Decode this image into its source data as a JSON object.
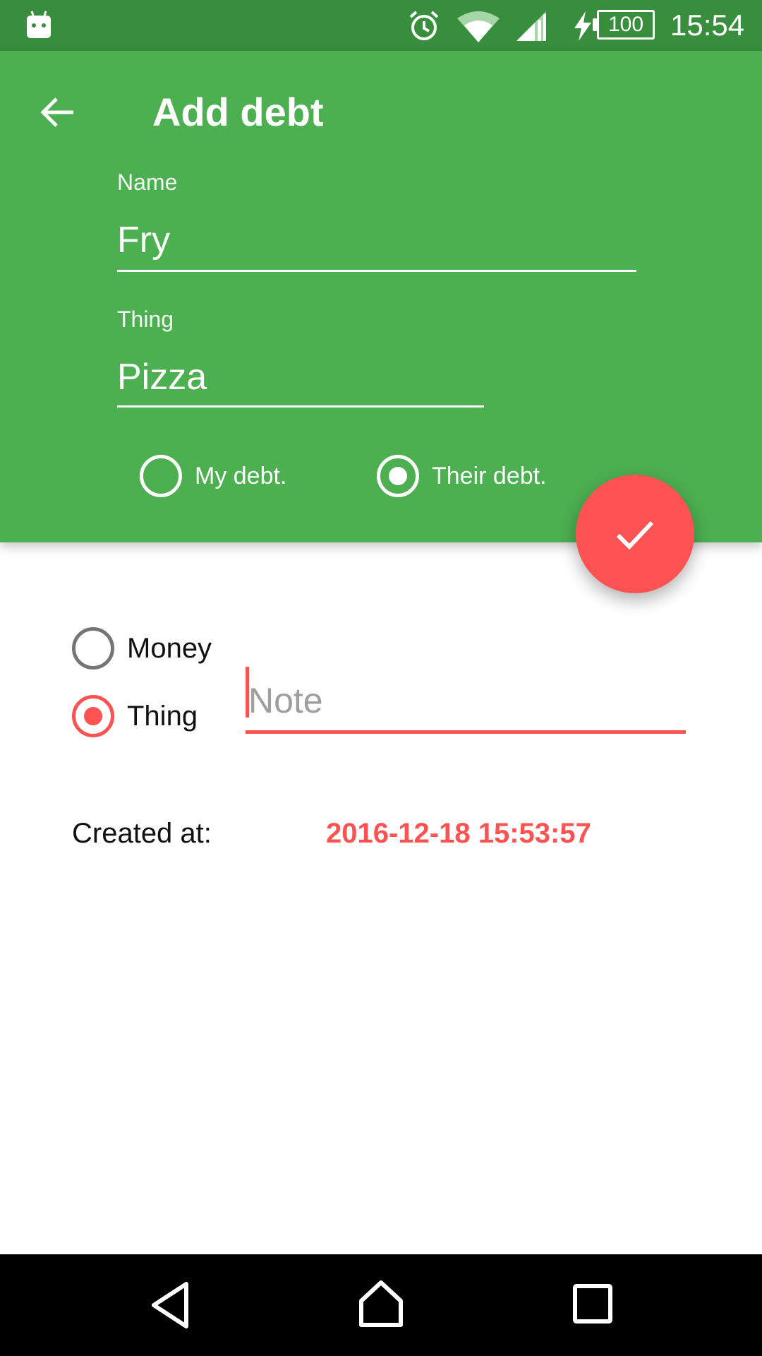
{
  "status_bar": {
    "time": "15:54",
    "battery": "100",
    "icons": [
      "android-icon",
      "alarm-icon",
      "wifi-icon",
      "signal-icon",
      "charging-icon",
      "battery-icon"
    ]
  },
  "toolbar": {
    "title": "Add debt",
    "back_icon": "arrow-back-icon"
  },
  "form": {
    "name_label": "Name",
    "name_value": "Fry",
    "thing_label": "Thing",
    "thing_value": "Pizza",
    "direction_options": [
      {
        "label": "My debt.",
        "checked": false
      },
      {
        "label": "Their debt.",
        "checked": true
      }
    ],
    "type_options": [
      {
        "label": "Money",
        "checked": false
      },
      {
        "label": "Thing",
        "checked": true
      }
    ],
    "note_placeholder": "Note",
    "note_value": "",
    "created_label": "Created at:",
    "created_value": "2016-12-18 15:53:57"
  },
  "fab": {
    "icon": "check-icon"
  },
  "colors": {
    "primary": "#4caf50",
    "primary_dark": "#388e3c",
    "accent": "#ff5252"
  }
}
